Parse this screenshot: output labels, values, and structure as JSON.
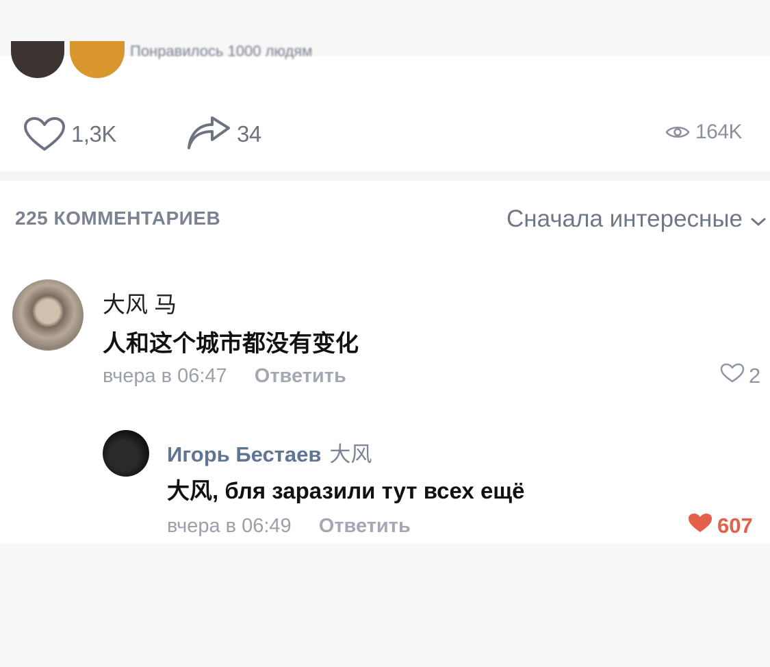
{
  "post": {
    "prev_text": "Понравилось 1000 людям",
    "likes": "1,3K",
    "shares": "34",
    "views": "164K"
  },
  "comments_header": {
    "count_label": "225 КОММЕНТАРИЕВ",
    "sort_label": "Сначала интересные"
  },
  "comments": [
    {
      "author": "大风 马",
      "text": "人和这个城市都没有变化",
      "time": "вчера в 06:47",
      "reply_label": "Ответить",
      "likes": "2",
      "liked": false
    },
    {
      "author": "Игорь Бестаев",
      "reply_to": "大风",
      "text": "大风, бля заразили тут всех ещё",
      "time": "вчера в 06:49",
      "reply_label": "Ответить",
      "likes": "607",
      "liked": true
    }
  ],
  "colors": {
    "icon_gray": "#6d7380",
    "liked_red": "#e4604a",
    "link_blue": "#5f7591",
    "meta_gray": "#9aa0aa"
  },
  "icons": {
    "like": "heart-outline-icon",
    "share": "share-arrow-icon",
    "views": "eye-icon",
    "sort": "chevron-down-icon",
    "liked": "heart-filled-icon"
  }
}
